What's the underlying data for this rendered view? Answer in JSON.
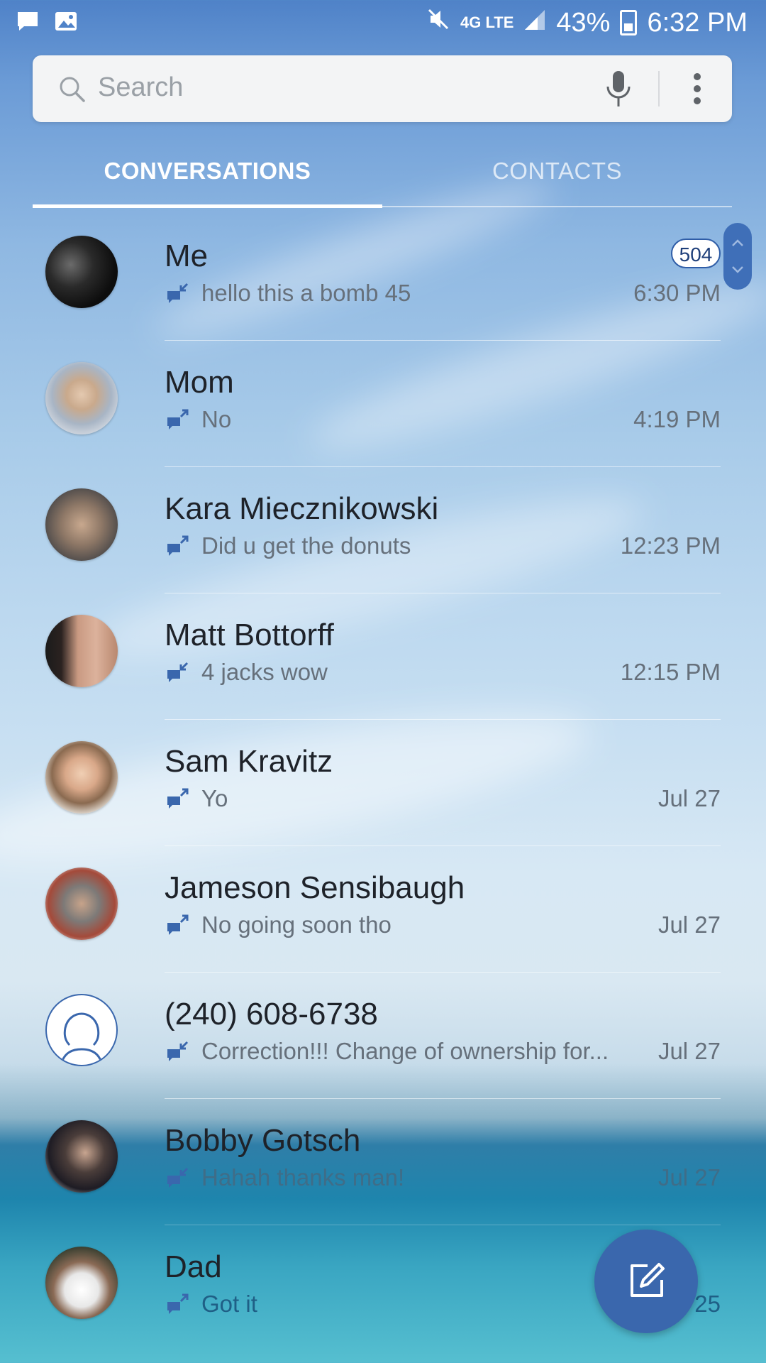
{
  "status_bar": {
    "battery": "43%",
    "time": "6:32 PM",
    "network": "4G LTE"
  },
  "search": {
    "placeholder": "Search"
  },
  "tabs": [
    {
      "label": "CONVERSATIONS",
      "active": true
    },
    {
      "label": "CONTACTS",
      "active": false
    }
  ],
  "conversations": [
    {
      "name": "Me",
      "preview": "hello this a bomb 45",
      "time": "6:30 PM",
      "badge": "504"
    },
    {
      "name": "Mom",
      "preview": "No",
      "time": "4:19 PM"
    },
    {
      "name": "Kara Miecznikowski",
      "preview": "Did u get the donuts",
      "time": "12:23 PM"
    },
    {
      "name": "Matt Bottorff",
      "preview": "4 jacks wow",
      "time": "12:15 PM"
    },
    {
      "name": "Sam Kravitz",
      "preview": "Yo",
      "time": "Jul 27"
    },
    {
      "name": "Jameson Sensibaugh",
      "preview": "No going soon tho",
      "time": "Jul 27"
    },
    {
      "name": "(240) 608-6738",
      "preview": "Correction!!!   Change of ownership for...",
      "time": "Jul 27"
    },
    {
      "name": "Bobby Gotsch",
      "preview": "Hahah thanks man!",
      "time": "Jul 27"
    },
    {
      "name": "Dad",
      "preview": "Got it",
      "time": "Jul 25"
    }
  ],
  "colors": {
    "accent": "#3a67ad",
    "text_primary": "#1e2229",
    "text_secondary": "#66707b"
  }
}
